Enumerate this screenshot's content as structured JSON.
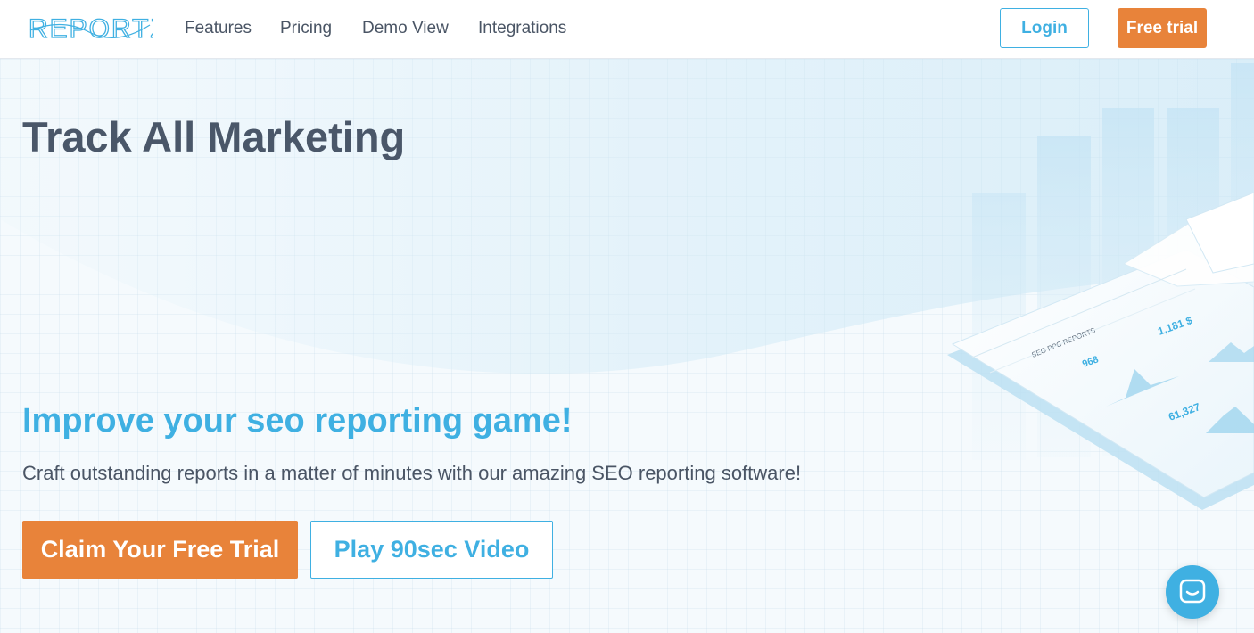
{
  "nav": {
    "logo_text": "REPORTZ",
    "links": [
      "Features",
      "Pricing",
      "Demo View",
      "Integrations"
    ],
    "login_label": "Login",
    "trial_label": "Free trial"
  },
  "hero": {
    "title": "Track All Marketing",
    "subtitle": "Improve your seo reporting game!",
    "description": "Craft outstanding reports in a matter of minutes with our amazing SEO reporting software!",
    "cta_primary": "Claim Your Free Trial",
    "cta_secondary": "Play 90sec Video"
  },
  "dashboard_illustration": {
    "panel_title": "SEO PPC REPORTS",
    "stats": [
      "968",
      "1,181 $",
      "61,327"
    ]
  },
  "chat": {
    "icon": "chat-bubble-icon"
  },
  "colors": {
    "accent_blue": "#3fb0e2",
    "accent_orange": "#e8833a",
    "text_dark": "#4a5769"
  }
}
